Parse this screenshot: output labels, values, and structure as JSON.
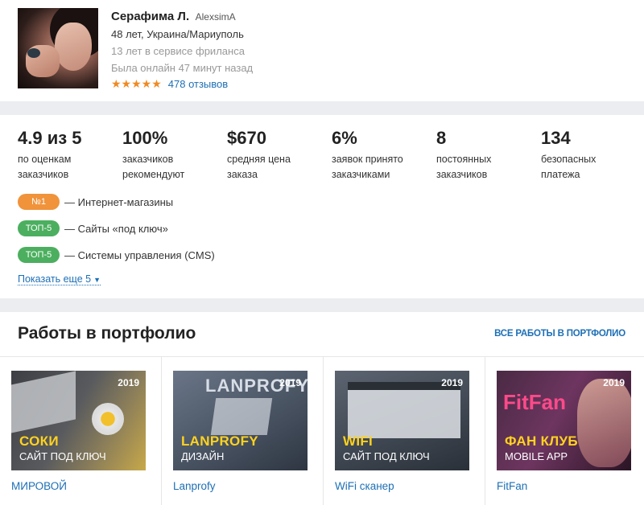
{
  "profile": {
    "name": "Серафима Л.",
    "login": "AlexsimA",
    "age_location": "48 лет, Украина/Мариуполь",
    "experience": "13 лет в сервисе фриланса",
    "last_online": "Была онлайн 47 минут назад",
    "rating_stars": 5,
    "stars_text": "★★★★★",
    "reviews": "478 отзывов"
  },
  "stats": [
    {
      "value": "4.9 из 5",
      "label_1": "по оценкам",
      "label_2": "заказчиков"
    },
    {
      "value": "100%",
      "label_1": "заказчиков",
      "label_2": "рекомендуют"
    },
    {
      "value": "$670",
      "label_1": "средняя цена",
      "label_2": "заказа"
    },
    {
      "value": "6%",
      "label_1": "заявок принято",
      "label_2": "заказчиками"
    },
    {
      "value": "8",
      "label_1": "постоянных",
      "label_2": "заказчиков"
    },
    {
      "value": "134",
      "label_1": "безопасных",
      "label_2": "платежа"
    }
  ],
  "ranks": [
    {
      "badge": "№1",
      "color": "#f0933a",
      "text": "— Интернет-магазины"
    },
    {
      "badge": "ТОП-5",
      "color": "#4caf5f",
      "text": "— Сайты «под ключ»"
    },
    {
      "badge": "ТОП-5",
      "color": "#4caf5f",
      "text": "— Системы управления (CMS)"
    }
  ],
  "show_more": "Показать еще 5",
  "portfolio": {
    "title": "Работы в портфолио",
    "all_link": "ВСЕ РАБОТЫ В ПОРТФОЛИО",
    "items": [
      {
        "year": "2019",
        "title": "СОКИ",
        "subtitle": "САЙТ ПОД КЛЮЧ",
        "caption": "МИРОВОЙ"
      },
      {
        "year": "2019",
        "title": "LANPROFY",
        "subtitle": "ДИЗАЙН",
        "caption": "Lanprofy",
        "logo": "LANPROFY"
      },
      {
        "year": "2019",
        "title": "WIFI",
        "subtitle": "САЙТ ПОД КЛЮЧ",
        "caption": "WiFi сканер"
      },
      {
        "year": "2019",
        "title": "ФАН КЛУБ",
        "subtitle": "MOBILE APP",
        "caption": "FitFan",
        "logo": "FitFan"
      }
    ]
  },
  "colors": {
    "link": "#1d6fb5",
    "star": "#f08a24",
    "title_yellow": "#ffd21f",
    "separator": "#ebedf0"
  }
}
